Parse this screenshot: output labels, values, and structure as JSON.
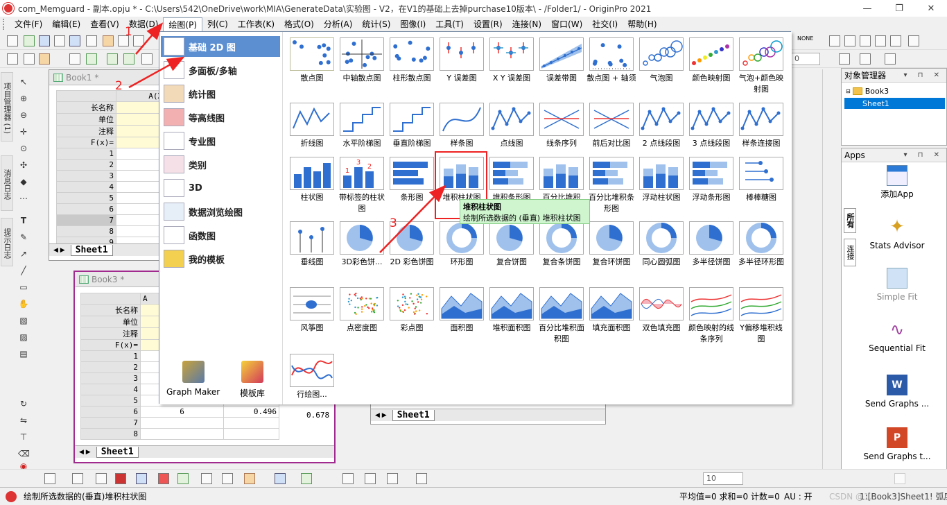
{
  "window": {
    "title": "com_Memguard - 副本.opju * - C:\\Users\\542\\OneDrive\\work\\MIA\\GenerateData\\实验图 - V2，在V1的基础上去掉purchase10版本\\ - /Folder1/ - OriginPro 2021",
    "minimize": "—",
    "restore": "❐",
    "close": "✕"
  },
  "menu": [
    "文件(F)",
    "编辑(E)",
    "查看(V)",
    "数据(D)",
    "绘图(P)",
    "列(C)",
    "工作表(K)",
    "格式(O)",
    "分析(A)",
    "统计(S)",
    "图像(I)",
    "工具(T)",
    "设置(R)",
    "连接(N)",
    "窗口(W)",
    "社交(I)",
    "帮助(H)"
  ],
  "toolbar": {
    "combo_none": "NONE",
    "combo_zero": "0"
  },
  "left_tabs": [
    "项目管理器 (1)",
    "消息日志",
    "提示日志"
  ],
  "book1": {
    "title": "Book1 *",
    "col_header": "A(X)",
    "row_labels": [
      "长名称",
      "单位",
      "注释",
      "F(x)="
    ],
    "rows": [
      "1",
      "2",
      "3",
      "4",
      "5",
      "6",
      "7",
      "8",
      "9"
    ],
    "tab": "Sheet1"
  },
  "book3": {
    "title": "Book3 *",
    "col_header": "A",
    "row_labels": [
      "长名称",
      "单位",
      "注释",
      "F(x)="
    ],
    "rows": [
      "1",
      "2",
      "3",
      "4",
      "5",
      "6",
      "7",
      "8"
    ],
    "row6": [
      "6",
      "0.496",
      "0.678"
    ],
    "tab": "Sheet1"
  },
  "book_bg": {
    "tab": "Sheet1"
  },
  "categories": [
    {
      "label": "基础 2D 图",
      "selected": true
    },
    {
      "label": "多面板/多轴"
    },
    {
      "label": "统计图"
    },
    {
      "label": "等高线图"
    },
    {
      "label": "专业图"
    },
    {
      "label": "类别"
    },
    {
      "label": "3D"
    },
    {
      "label": "数据浏览绘图"
    },
    {
      "label": "函数图"
    },
    {
      "label": "我的模板"
    }
  ],
  "graph_maker": "Graph Maker",
  "template_lib": "模板库",
  "gallery": [
    [
      "散点图",
      "中轴散点图",
      "柱形散点图",
      "Y 误差图",
      "X Y 误差图",
      "误差带图",
      "散点图 + 轴须",
      "气泡图",
      "颜色映射图",
      "气泡+颜色映射图"
    ],
    [
      "折线图",
      "水平阶梯图",
      "垂直阶梯图",
      "样条图",
      "点线图",
      "线条序列",
      "前后对比图",
      "2 点线段图",
      "3 点线段图",
      "样条连接图"
    ],
    [
      "柱状图",
      "带标签的柱状图",
      "条形图",
      "堆积柱状图",
      "堆积条形图",
      "百分比堆积",
      "百分比堆积条形图",
      "浮动柱状图",
      "浮动条形图",
      "棒棒糖图"
    ],
    [
      "垂线图",
      "3D彩色饼...",
      "2D 彩色饼图",
      "环形图",
      "复合饼图",
      "复合条饼图",
      "复合环饼图",
      "同心圆弧图",
      "多半径饼图",
      "多半径环形图"
    ],
    [
      "风筝图",
      "点密度图",
      "彩点图",
      "面积图",
      "堆积面积图",
      "百分比堆积面积图",
      "填充面积图",
      "双色填充图",
      "颜色映射的线条序列",
      "Y偏移堆积线图"
    ],
    [
      "行绘图..."
    ]
  ],
  "bar_labels": [
    "1",
    "3",
    "2"
  ],
  "tooltip": {
    "title": "堆积柱状图",
    "desc": "绘制所选数据的 (垂直) 堆积柱状图"
  },
  "annotations": [
    "1",
    "2",
    "3"
  ],
  "object_manager": {
    "title": "对象管理器",
    "controls": "▾ ⊓ ✕",
    "book": "Book3",
    "sheet": "Sheet1"
  },
  "apps_panel": {
    "title": "Apps",
    "controls": "▾ ⊓ ✕",
    "tabs": [
      "所有",
      "连接"
    ],
    "items": [
      "添加App",
      "Stats Advisor",
      "Simple Fit",
      "Sequential Fit",
      "Send Graphs ...",
      "Send Graphs t..."
    ]
  },
  "bottom_combo": "10",
  "status": {
    "left": "绘制所选数据的(垂直)堆积柱状图",
    "stats": "平均值=0 求和=0 计数=0",
    "au": "AU : 开",
    "watermark": "CSDN @1....",
    "sheet": "1:[Book3]Sheet1!  弧度"
  },
  "colors": {
    "accent": "#5b8fd1",
    "highlight": "#e22222",
    "tooltip_bg": "#cff5cf",
    "bar_blue": "#2f6fd0"
  }
}
